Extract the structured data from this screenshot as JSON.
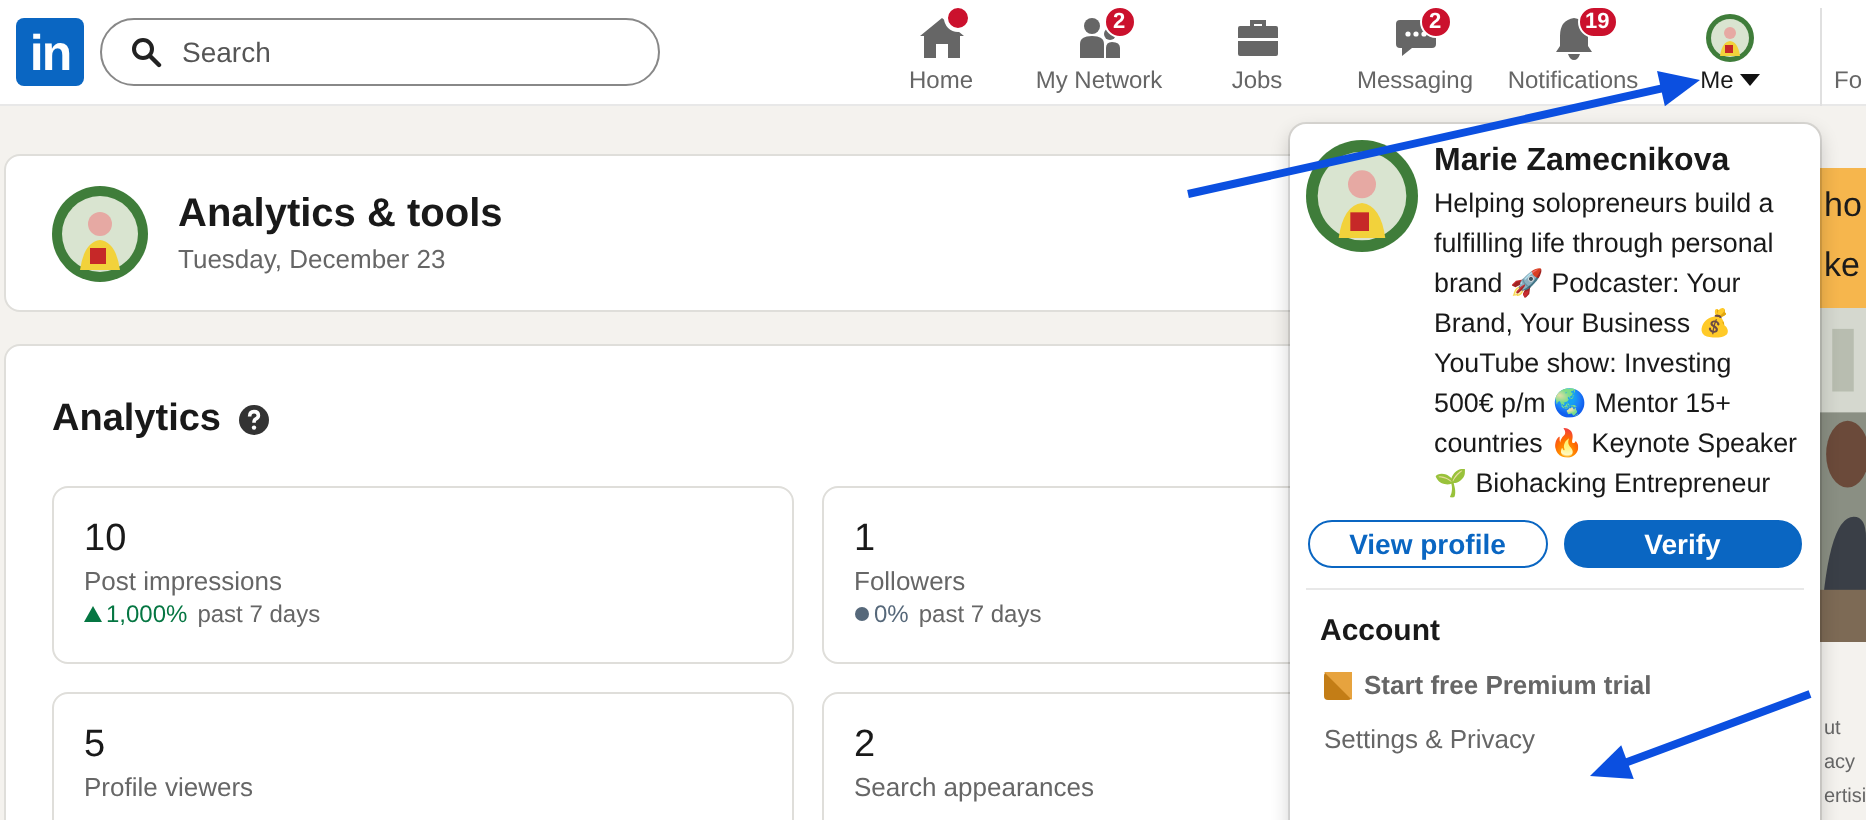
{
  "nav": {
    "logo": "in",
    "search": {
      "placeholder": "Search"
    },
    "items": [
      {
        "kind": "home",
        "label": "Home",
        "badge_dot": true
      },
      {
        "kind": "people",
        "label": "My Network",
        "badge": "2"
      },
      {
        "kind": "briefcase",
        "label": "Jobs"
      },
      {
        "kind": "chat",
        "label": "Messaging",
        "badge": "2"
      },
      {
        "kind": "bell",
        "label": "Notifications",
        "badge": "19"
      }
    ],
    "me": {
      "label": "Me",
      "expanded": true
    },
    "cut_item": "Fo"
  },
  "header": {
    "title": "Analytics & tools",
    "date": "Tuesday, December 23"
  },
  "analytics": {
    "title": "Analytics",
    "tiles": [
      {
        "value": "10",
        "label": "Post impressions",
        "trend": {
          "kind": "up",
          "change": "1,000%",
          "period": "past 7 days"
        }
      },
      {
        "value": "1",
        "label": "Followers",
        "trend": {
          "kind": "flat",
          "change": "0%",
          "period": "past 7 days"
        }
      },
      {
        "value": "5",
        "label": "Profile viewers"
      },
      {
        "value": "2",
        "label": "Search appearances"
      }
    ]
  },
  "rail": {
    "ad_lines": [
      "ho",
      "ke"
    ],
    "footer_links": [
      "ut",
      "acy",
      "ertisi"
    ]
  },
  "me_menu": {
    "name": "Marie Zamecnikova",
    "headline": "Helping solopreneurs build a fulfilling life through personal brand 🚀 Podcaster: Your Brand, Your Business 💰 YouTube show: Investing 500€ p/m 🌏 Mentor 15+ countries 🔥 Keynote Speaker 🌱 Biohacking Entrepreneur",
    "buttons": [
      {
        "label": "View profile",
        "kind": "outline"
      },
      {
        "label": "Verify",
        "kind": "primary"
      }
    ],
    "section": "Account",
    "items": [
      {
        "label": "Start free Premium trial",
        "kind": "premium"
      },
      {
        "label": "Settings & Privacy",
        "kind": "plain"
      }
    ]
  },
  "annotations": [
    {
      "kind": "arrow"
    },
    {
      "kind": "arrow"
    }
  ]
}
